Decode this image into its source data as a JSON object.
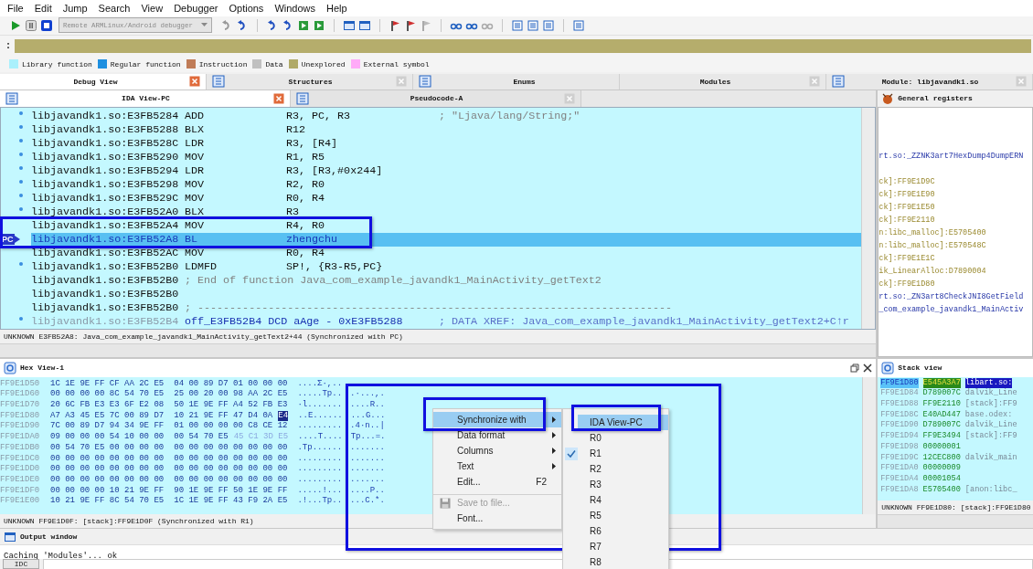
{
  "menu_bar": [
    "File",
    "Edit",
    "Jump",
    "Search",
    "View",
    "Debugger",
    "Options",
    "Windows",
    "Help"
  ],
  "toolbar": {
    "debugger_combo": {
      "value": "Remote ARMLinux/Android debugger",
      "disabled": true
    }
  },
  "navigator": {
    "marker": ":"
  },
  "legend": [
    {
      "label": "Library function",
      "color": "#aaf0fc"
    },
    {
      "label": "Regular function",
      "color": "#1e8fe0"
    },
    {
      "label": "Instruction",
      "color": "#c07c58"
    },
    {
      "label": "Data",
      "color": "#c0c0c0"
    },
    {
      "label": "Unexplored",
      "color": "#b0aa68"
    },
    {
      "label": "External symbol",
      "color": "#ffaaf8"
    }
  ],
  "top_tabs": [
    {
      "label": "Debug View",
      "selected": true,
      "kind": "plain",
      "closable": true
    },
    {
      "label": "Structures",
      "selected": false,
      "kind": "with-icon",
      "closable": true
    },
    {
      "label": "Enums",
      "selected": false,
      "kind": "with-icon",
      "closable": false
    },
    {
      "label": "Modules",
      "selected": false,
      "kind": "plain",
      "closable": true
    },
    {
      "label": "Module: libjavandk1.so",
      "selected": false,
      "kind": "with-icon",
      "closable": true
    }
  ],
  "ida_view": {
    "tabs": [
      {
        "label": "IDA View-PC",
        "selected": true
      },
      {
        "label": "Pseudocode-A",
        "selected": false
      }
    ],
    "lines": [
      {
        "address": "libjavandk1.so:E3FB5284",
        "mnemonic": "ADD",
        "operands": "R3, PC, R3",
        "comment": "; \"Ljava/lang/String;\"",
        "kind": "code",
        "bullet": true,
        "selected": false
      },
      {
        "address": "libjavandk1.so:E3FB5288",
        "mnemonic": "BLX",
        "operands": "R12",
        "kind": "code",
        "bullet": true,
        "selected": false
      },
      {
        "address": "libjavandk1.so:E3FB528C",
        "mnemonic": "LDR",
        "operands": "R3, [R4]",
        "kind": "code",
        "bullet": true,
        "selected": false
      },
      {
        "address": "libjavandk1.so:E3FB5290",
        "mnemonic": "MOV",
        "operands": "R1, R5",
        "kind": "code",
        "bullet": true,
        "selected": false
      },
      {
        "address": "libjavandk1.so:E3FB5294",
        "mnemonic": "LDR",
        "operands": "R3, [R3,#0x244]",
        "kind": "code",
        "bullet": true,
        "selected": false
      },
      {
        "address": "libjavandk1.so:E3FB5298",
        "mnemonic": "MOV",
        "operands": "R2, R0",
        "kind": "code",
        "bullet": true,
        "selected": false
      },
      {
        "address": "libjavandk1.so:E3FB529C",
        "mnemonic": "MOV",
        "operands": "R0, R4",
        "kind": "code",
        "bullet": true,
        "selected": false
      },
      {
        "address": "libjavandk1.so:E3FB52A0",
        "mnemonic": "BLX",
        "operands": "R3",
        "kind": "code",
        "bullet": true,
        "selected": false
      },
      {
        "address": "libjavandk1.so:E3FB52A4",
        "mnemonic": "MOV",
        "operands": "R4, R0",
        "kind": "code",
        "bullet": false,
        "selected": false
      },
      {
        "address": "libjavandk1.so:E3FB52A8",
        "mnemonic": "BL",
        "operands": "zhengchu",
        "kind": "code",
        "bullet": false,
        "selected": true,
        "pc_marker": "PC"
      },
      {
        "address": "libjavandk1.so:E3FB52AC",
        "mnemonic": "MOV",
        "operands": "R0, R4",
        "kind": "code",
        "bullet": false,
        "selected": false
      },
      {
        "address": "libjavandk1.so:E3FB52B0",
        "mnemonic": "LDMFD",
        "operands": "SP!, {R3-R5,PC}",
        "kind": "code",
        "bullet": true,
        "selected": false
      },
      {
        "address": "libjavandk1.so:E3FB52B0",
        "comment": "; End of function Java_com_example_javandk1_MainActivity_getText2",
        "kind": "comment",
        "bullet": false,
        "selected": false
      },
      {
        "address": "libjavandk1.so:E3FB52B0",
        "kind": "comment",
        "bullet": false,
        "selected": false
      },
      {
        "address": "libjavandk1.so:E3FB52B0",
        "comment": "; --------------------------------------------------------------------------",
        "kind": "comment",
        "bullet": false,
        "selected": false
      },
      {
        "address": "libjavandk1.so:E3FB52B4",
        "definition": "off_E3FB52B4 DCD aAge - 0xE3FB5288",
        "comment": "; DATA XREF: Java_com_example_javandk1_MainActivity_getText2+C↑r",
        "kind": "data",
        "bullet": true,
        "selected": false
      }
    ],
    "status": "UNKNOWN E3FB52A8: Java_com_example_javandk1_MainActivity_getText2+44 (Synchronized with PC)"
  },
  "registers": {
    "title": "General registers",
    "lines": [
      {
        "text": "rt.so:_ZZNK3art7HexDump4DumpERN",
        "kind": "code"
      },
      {
        "kind": "blank"
      },
      {
        "text": "ck]:FF9E1D9C",
        "kind": "stack"
      },
      {
        "text": "ck]:FF9E1E90",
        "kind": "stack"
      },
      {
        "text": "ck]:FF9E1E50",
        "kind": "stack"
      },
      {
        "text": "ck]:FF9E2110",
        "kind": "stack"
      },
      {
        "text": "n:libc_malloc]:E5705400",
        "kind": "stack"
      },
      {
        "text": "n:libc_malloc]:E570548C",
        "kind": "stack"
      },
      {
        "text": "ck]:FF9E1E1C",
        "kind": "stack"
      },
      {
        "text": "ik_LinearAlloc:D7890004",
        "kind": "stack"
      },
      {
        "text": "ck]:FF9E1D80",
        "kind": "stack"
      },
      {
        "text": "rt.so:_ZN3art8CheckJNI8GetField",
        "kind": "code"
      },
      {
        "text": "_com_example_javandk1_MainActiv",
        "kind": "code"
      }
    ]
  },
  "hex_view": {
    "title": "Hex View-1",
    "rows": [
      {
        "address": "FF9E1D50",
        "bytes": [
          "1C 1E 9E FF CF AA 2C E5",
          "04 00 89 D7 01 00 00 00"
        ],
        "ascii": [
          "....Σ·,.."
        ]
      },
      {
        "address": "FF9E1D60",
        "bytes": [
          "00 00 00 00 8C 54 70 E5",
          "25 00 20 00 98 AA 2C E5"
        ],
        "ascii": [
          ".....Tp..",
          ".·...,."
        ]
      },
      {
        "address": "FF9E1D70",
        "bytes": [
          "20 6C FB E3 E3 6F E2 08",
          "50 1E 9E FF A4 52 FB E3"
        ],
        "ascii": [
          "·l.......",
          "....R.."
        ]
      },
      {
        "address": "FF9E1D80",
        "bytes": [
          "A7 A3 45 E5 7C 00 89 D7",
          "10 21 9E FF 47 D4 0A"
        ],
        "cursor_byte": "E4",
        "ascii": [
          "..E......",
          "...G..."
        ]
      },
      {
        "address": "FF9E1D90",
        "bytes": [
          "7C 00 89 D7 94 34 9E FF",
          "01 00 00 00 00 C8 CE 12"
        ],
        "ascii": [
          ".........",
          ".4·n..|"
        ]
      },
      {
        "address": "FF9E1DA0",
        "bytes": [
          "09 00 00 00 54 10 00 00",
          "00 54 70 E5"
        ],
        "faded_bytes": "45 C1 3D E5",
        "ascii": [
          "....T....",
          "Tp...=."
        ]
      },
      {
        "address": "FF9E1DB0",
        "bytes": [
          "00 54 70 E5 00 00 00 00",
          "00 00 00 00 00 00 00 00"
        ],
        "ascii": [
          ".Tp......",
          "......."
        ]
      },
      {
        "address": "FF9E1DC0",
        "bytes": [
          "00 00 00 00 00 00 00 00",
          "00 00 00 00 00 00 00 00"
        ],
        "ascii": [
          ".........",
          "......."
        ]
      },
      {
        "address": "FF9E1DD0",
        "bytes": [
          "00 00 00 00 00 00 00 00",
          "00 00 00 00 00 00 00 00"
        ],
        "ascii": [
          ".........",
          "......."
        ]
      },
      {
        "address": "FF9E1DE0",
        "bytes": [
          "00 00 00 00 00 00 00 00",
          "00 00 00 00 00 00 00 00"
        ],
        "ascii": [
          ".........",
          "......."
        ]
      },
      {
        "address": "FF9E1DF0",
        "bytes": [
          "00 00 00 00 10 21 9E FF",
          "90 1E 9E FF 50 1E 9E FF"
        ],
        "ascii": [
          ".....!...",
          "....P.."
        ]
      },
      {
        "address": "FF9E1E00",
        "bytes": [
          "10 21 9E FF 8C 54 70 E5",
          "1C 1E 9E FF 43 F9 2A E5"
        ],
        "ascii": [
          ".!...Tp..",
          "...C.*."
        ]
      }
    ],
    "status": "UNKNOWN FF9E1D0F: [stack]:FF9E1D0F (Synchronized with R1)"
  },
  "stack_view": {
    "title": "Stack view",
    "rows": [
      {
        "address": "FF9E1D80",
        "value": "E545A3A7",
        "comment": "libart.so:",
        "selected": true
      },
      {
        "address": "FF9E1D84",
        "value": "D789007C",
        "comment": "dalvik_Line",
        "selected": false
      },
      {
        "address": "FF9E1D88",
        "value": "FF9E2110",
        "comment": "[stack]:FF9",
        "selected": false
      },
      {
        "address": "FF9E1D8C",
        "value": "E40AD447",
        "comment": "base.odex:",
        "selected": false
      },
      {
        "address": "FF9E1D90",
        "value": "D789007C",
        "comment": "dalvik_Line",
        "selected": false
      },
      {
        "address": "FF9E1D94",
        "value": "FF9E3494",
        "comment": "[stack]:FF9",
        "selected": false
      },
      {
        "address": "FF9E1D98",
        "value": "00000001",
        "selected": false
      },
      {
        "address": "FF9E1D9C",
        "value": "12CEC800",
        "comment": "dalvik_main",
        "selected": false
      },
      {
        "address": "FF9E1DA0",
        "value": "00000009",
        "selected": false
      },
      {
        "address": "FF9E1DA4",
        "value": "00001054",
        "selected": false
      },
      {
        "address": "FF9E1DA8",
        "value": "E5705400",
        "comment": "[anon:libc_",
        "selected": false
      }
    ],
    "status": "UNKNOWN FF9E1D80: [stack]:FF9E1D80"
  },
  "output_window": {
    "title": "Output window",
    "lines": [
      "Caching 'Modules'... ok"
    ],
    "input_label": "IDC"
  },
  "context_menu": {
    "items": [
      {
        "label": "Synchronize with",
        "kind": "submenu",
        "selected": true,
        "disabled": false,
        "separator_before": false
      },
      {
        "label": "Data format",
        "kind": "submenu",
        "selected": false,
        "disabled": false,
        "separator_before": false
      },
      {
        "label": "Columns",
        "kind": "submenu",
        "selected": false,
        "disabled": false,
        "separator_before": false
      },
      {
        "label": "Text",
        "kind": "submenu",
        "selected": false,
        "disabled": false,
        "separator_before": false
      },
      {
        "label": "Edit...",
        "shortcut": "F2",
        "kind": "command",
        "selected": false,
        "disabled": false,
        "separator_before": false
      },
      {
        "label": "Save to file...",
        "kind": "save",
        "selected": false,
        "disabled": true,
        "separator_before": true
      },
      {
        "label": "Font...",
        "kind": "command",
        "selected": false,
        "disabled": false,
        "separator_before": false
      }
    ]
  },
  "submenu": {
    "items": [
      {
        "label": "IDA View-PC",
        "selected": true,
        "checked": false
      },
      {
        "label": "R0",
        "selected": false,
        "checked": false
      },
      {
        "label": "R1",
        "selected": false,
        "checked": true
      },
      {
        "label": "R2",
        "selected": false,
        "checked": false
      },
      {
        "label": "R3",
        "selected": false,
        "checked": false
      },
      {
        "label": "R4",
        "selected": false,
        "checked": false
      },
      {
        "label": "R5",
        "selected": false,
        "checked": false
      },
      {
        "label": "R6",
        "selected": false,
        "checked": false
      },
      {
        "label": "R7",
        "selected": false,
        "checked": false
      },
      {
        "label": "R8",
        "selected": false,
        "checked": false
      }
    ]
  }
}
